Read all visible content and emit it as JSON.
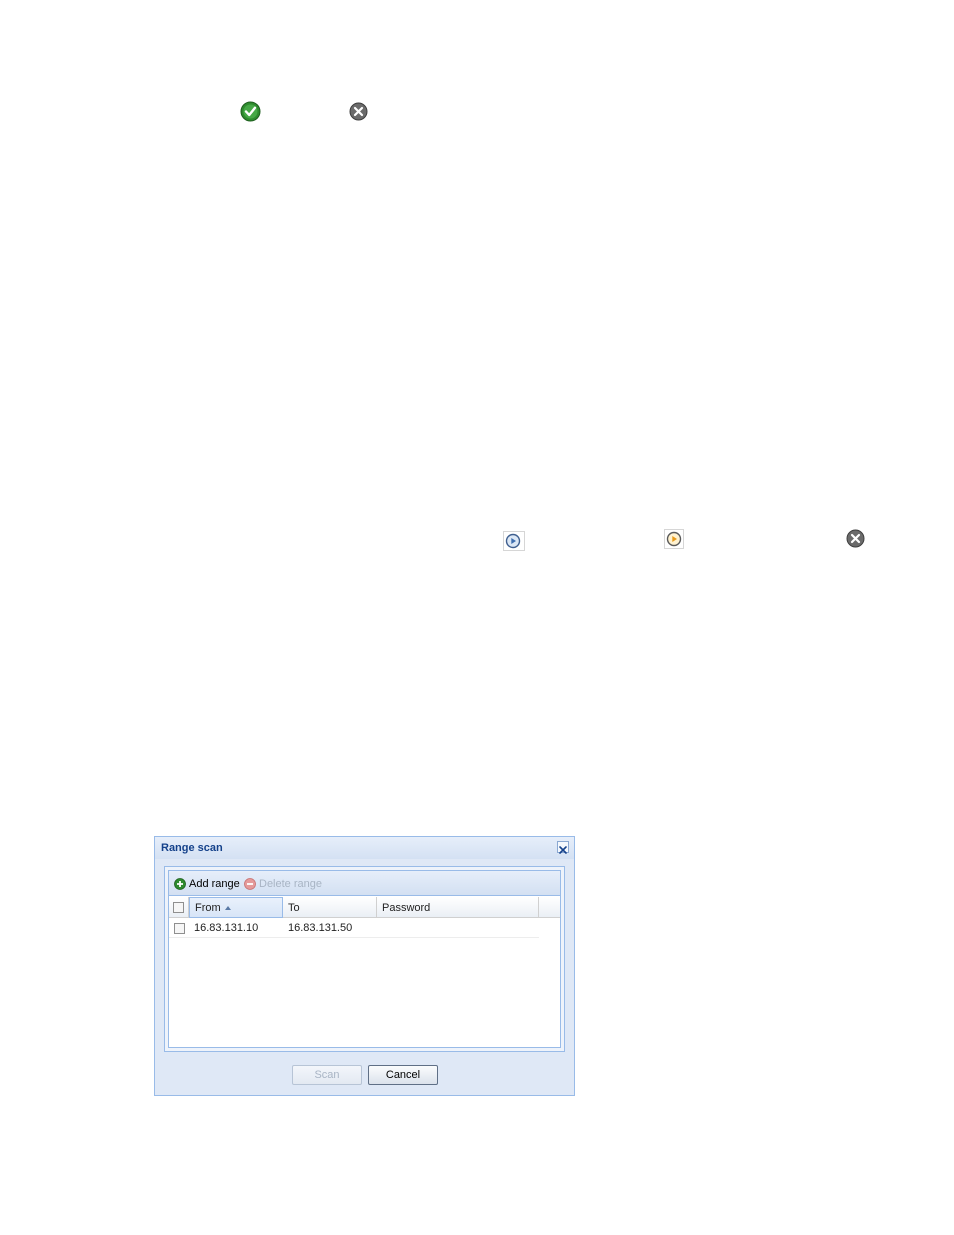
{
  "icons": {
    "check": "check-circle-icon",
    "close_top": "close-circle-icon",
    "play_blue": "play-blue-icon",
    "play_orange": "play-orange-icon",
    "close_mid": "close-circle-icon"
  },
  "dialog": {
    "title": "Range scan",
    "toolbar": {
      "add_label": "Add range",
      "delete_label": "Delete range"
    },
    "columns": [
      "From",
      "To",
      "Password"
    ],
    "sort_column": "From",
    "rows": [
      {
        "from": "16.83.131.10",
        "to": "16.83.131.50",
        "password": ""
      }
    ],
    "buttons": {
      "scan": "Scan",
      "cancel": "Cancel"
    }
  },
  "colors": {
    "title": "#15428b",
    "border": "#99bbe8",
    "check_green": "#2e8b2e",
    "close_gray": "#6b6b6b",
    "disabled_text": "#a8b4c4"
  }
}
